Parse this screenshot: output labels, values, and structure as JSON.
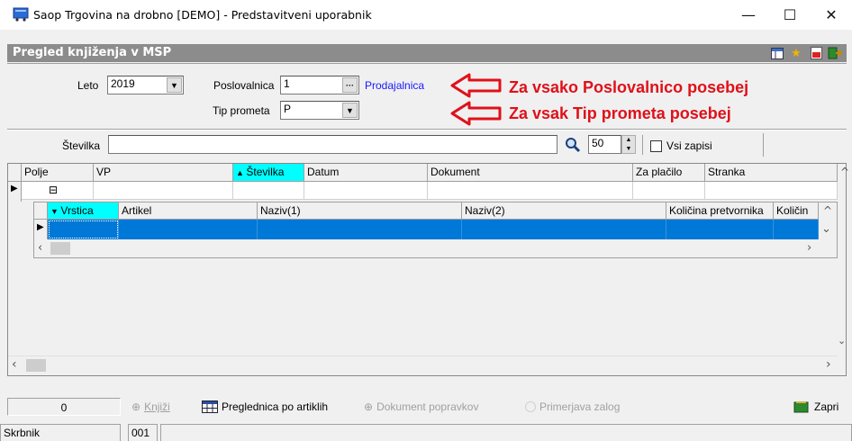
{
  "window": {
    "title": "Saop Trgovina na drobno [DEMO] - Predstavitveni uporabnik",
    "minimize": "—",
    "maximize": "☐",
    "close": "✕"
  },
  "form": {
    "caption": "Pregled knjiženja v MSP"
  },
  "filters": {
    "leto_label": "Leto",
    "leto_value": "2019",
    "poslovalnica_label": "Poslovalnica",
    "poslovalnica_value": "1",
    "poslovalnica_browse": "···",
    "poslovalnica_name": "Prodajalnica",
    "tip_prometa_label": "Tip prometa",
    "tip_prometa_value": "P",
    "stevilka_label": "Številka",
    "stevilka_value": "",
    "count_value": "50",
    "vsi_zapisi_label": "Vsi zapisi"
  },
  "annotations": {
    "line1": "Za vsako Poslovalnico posebej",
    "line2": "Za vsak Tip prometa posebej",
    "arrow_color": "#e0101a"
  },
  "grid": {
    "columns": [
      "Polje",
      "VP",
      "Številka",
      "Datum",
      "Dokument",
      "Za plačilo",
      "Stranka"
    ],
    "sorted_column": "Številka",
    "expand_glyph": "⊟",
    "detail_columns": [
      "Vrstica",
      "Artikel",
      "Naziv(1)",
      "Naziv(2)",
      "Količina pretvornika",
      "Količin"
    ],
    "detail_sorted_column": "Vrstica"
  },
  "toolbar": {
    "count": "0",
    "knjizi": "Knjiži",
    "preglednica": "Preglednica po artiklih",
    "dokument_popravkov": "Dokument popravkov",
    "primerjava_zalog": "Primerjava zalog",
    "zapri": "Zapri"
  },
  "status": {
    "user": "Skrbnik",
    "code": "001"
  },
  "colors": {
    "caption_bg": "#8c8c8c",
    "selected_header": "#00ffff",
    "selected_row": "#0078d7",
    "link": "#1a1aff"
  }
}
